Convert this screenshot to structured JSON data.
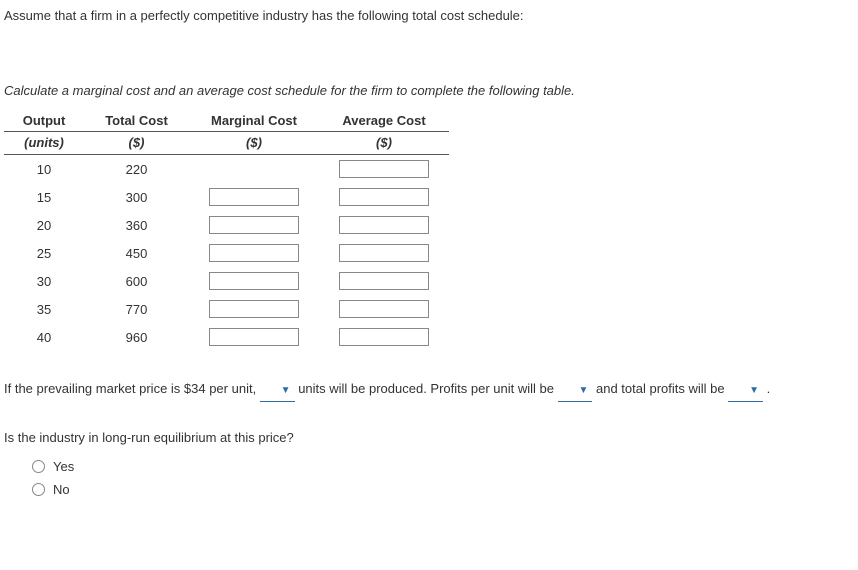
{
  "intro": "Assume that a firm in a perfectly competitive industry has the following total cost schedule:",
  "instruction": "Calculate a marginal cost and an average cost schedule for the firm to complete the following table.",
  "table": {
    "headers": {
      "output": "Output",
      "output_sub": "(units)",
      "total_cost": "Total Cost",
      "total_cost_sub": "($)",
      "marginal_cost": "Marginal Cost",
      "marginal_cost_sub": "($)",
      "average_cost": "Average Cost",
      "average_cost_sub": "($)"
    },
    "rows": [
      {
        "output": "10",
        "total_cost": "220",
        "has_mc": false,
        "has_ac": true
      },
      {
        "output": "15",
        "total_cost": "300",
        "has_mc": true,
        "has_ac": true
      },
      {
        "output": "20",
        "total_cost": "360",
        "has_mc": true,
        "has_ac": true
      },
      {
        "output": "25",
        "total_cost": "450",
        "has_mc": true,
        "has_ac": true
      },
      {
        "output": "30",
        "total_cost": "600",
        "has_mc": true,
        "has_ac": true
      },
      {
        "output": "35",
        "total_cost": "770",
        "has_mc": true,
        "has_ac": true
      },
      {
        "output": "40",
        "total_cost": "960",
        "has_mc": true,
        "has_ac": true
      }
    ]
  },
  "sentence": {
    "part1": "If the prevailing market price is $34 per unit,",
    "part2": "units will be produced. Profits per unit will be",
    "part3": "and total profits will be",
    "part4": "."
  },
  "question2": "Is the industry in long-run equilibrium at this price?",
  "radios": {
    "yes": "Yes",
    "no": "No"
  }
}
